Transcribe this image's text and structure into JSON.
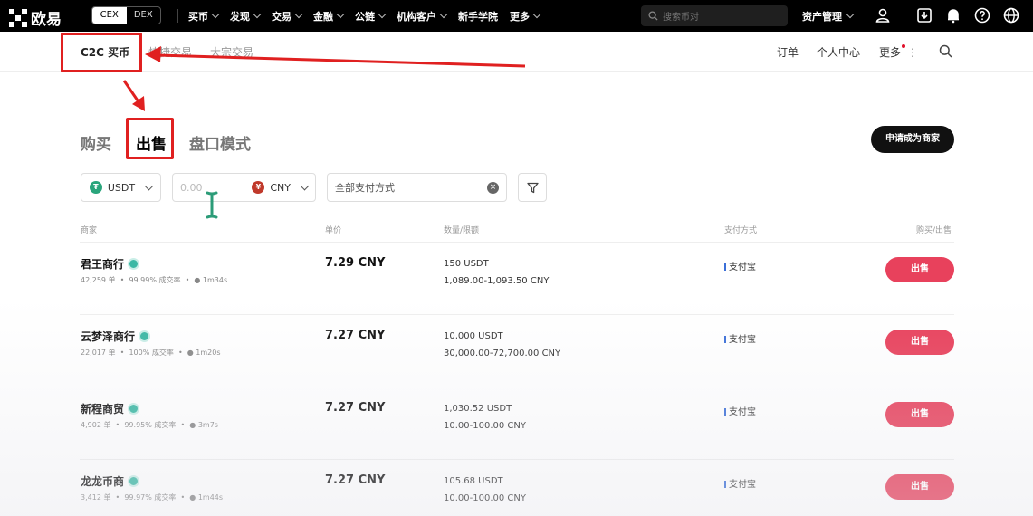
{
  "topbar": {
    "logo": "欧易",
    "cex": "CEX",
    "dex": "DEX",
    "nav": [
      "买币",
      "发现",
      "交易",
      "金融",
      "公链",
      "机构客户",
      "新手学院",
      "更多"
    ],
    "nav_has_caret": [
      true,
      true,
      true,
      true,
      true,
      true,
      false,
      true
    ],
    "search_placeholder": "搜索币对",
    "assets": "资产管理"
  },
  "subhead": {
    "tabs": [
      "C2C 买币",
      "快捷交易",
      "大宗交易"
    ],
    "right": [
      "订单",
      "个人中心",
      "更多"
    ]
  },
  "main": {
    "tabs": [
      "购买",
      "出售",
      "盘口模式"
    ],
    "merchant_button": "申请成为商家"
  },
  "filters": {
    "coin": "USDT",
    "amount_placeholder": "0.00",
    "currency": "CNY",
    "payment": "全部支付方式"
  },
  "table": {
    "headers": [
      "商家",
      "单价",
      "数量/限额",
      "支付方式",
      "购买/出售"
    ],
    "rows": [
      {
        "name": "君王商行",
        "orders": "42,259 单",
        "rate": "99.99% 成交率",
        "time": "1m34s",
        "price": "7.29 CNY",
        "qty": "150 USDT",
        "limit": "1,089.00-1,093.50 CNY",
        "pay": "支付宝",
        "action": "出售"
      },
      {
        "name": "云梦泽商行",
        "orders": "22,017 单",
        "rate": "100% 成交率",
        "time": "1m20s",
        "price": "7.27 CNY",
        "qty": "10,000 USDT",
        "limit": "30,000.00-72,700.00 CNY",
        "pay": "支付宝",
        "action": "出售"
      },
      {
        "name": "新程商贸",
        "orders": "4,902 单",
        "rate": "99.95% 成交率",
        "time": "3m7s",
        "price": "7.27 CNY",
        "qty": "1,030.52 USDT",
        "limit": "10.00-100.00 CNY",
        "pay": "支付宝",
        "action": "出售"
      },
      {
        "name": "龙龙币商",
        "orders": "3,412 单",
        "rate": "99.97% 成交率",
        "time": "1m44s",
        "price": "7.27 CNY",
        "qty": "105.68 USDT",
        "limit": "10.00-100.00 CNY",
        "pay": "支付宝",
        "action": "出售"
      }
    ]
  },
  "colors": {
    "accent_red": "#e8415c",
    "annotation": "#e02020",
    "verified": "#3bb8a4"
  }
}
